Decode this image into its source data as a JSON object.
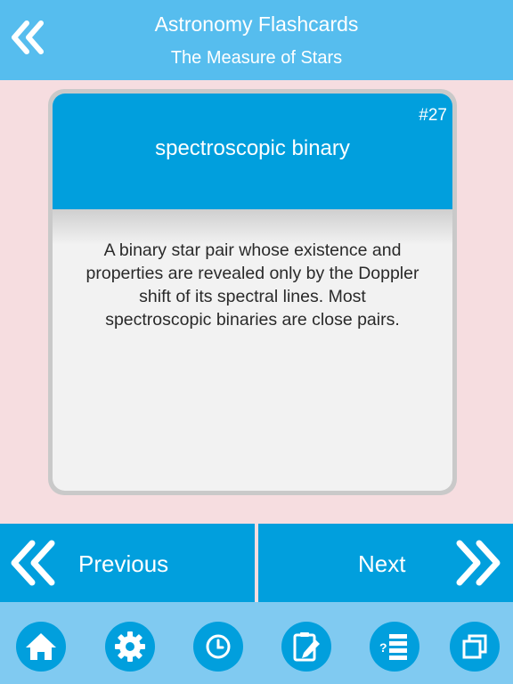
{
  "header": {
    "title": "Astronomy Flashcards",
    "subtitle": "The Measure of Stars",
    "back_icon": "double-chevron-left-icon"
  },
  "card": {
    "number": "#27",
    "term": "spectroscopic binary",
    "definition_lines": [
      "A binary star pair whose existence and",
      "properties are revealed only by the Doppler",
      "shift of its spectral lines. Most",
      "spectroscopic binaries are close pairs."
    ]
  },
  "navigation": {
    "previous_label": "Previous",
    "next_label": "Next"
  },
  "toolbar": {
    "items": [
      "home-icon",
      "gear-icon",
      "clock-icon",
      "edit-note-icon",
      "quiz-list-icon",
      "cards-icon"
    ]
  },
  "colors": {
    "header": "#56bdee",
    "accent": "#019fdd",
    "toolbar": "#80caf1",
    "background": "#f6dde0",
    "card": "#f2f2f2"
  }
}
